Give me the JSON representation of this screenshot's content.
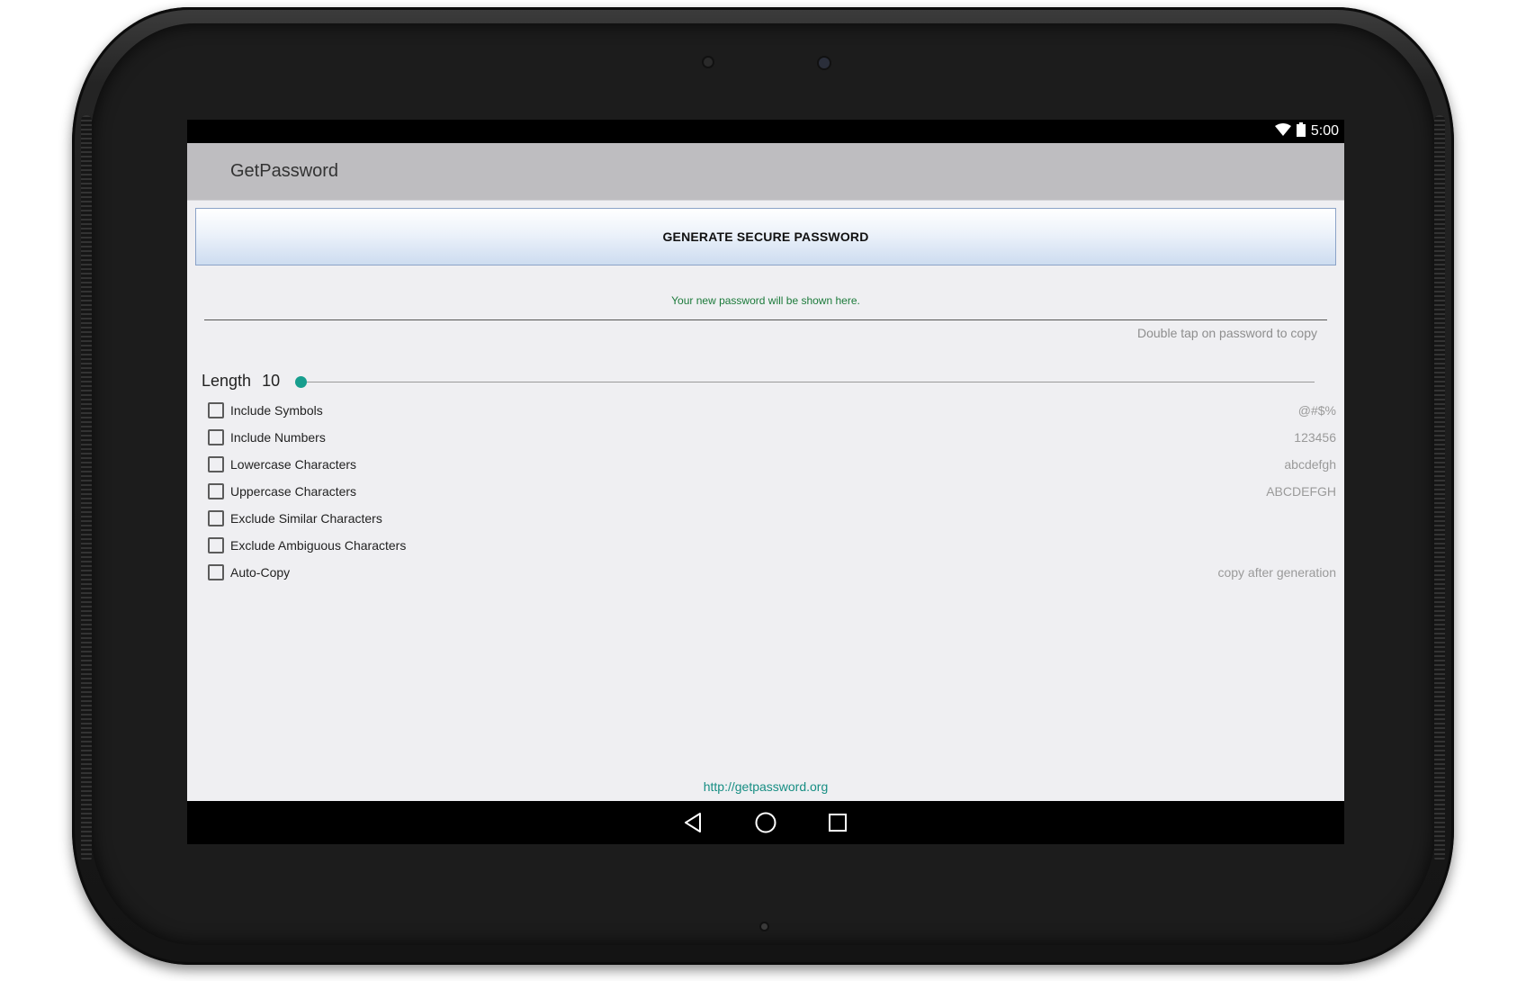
{
  "status_bar": {
    "time": "5:00",
    "icons": [
      "wifi-icon",
      "battery-icon"
    ]
  },
  "app": {
    "title": "GetPassword",
    "generate_button_label": "GENERATE SECURE PASSWORD",
    "password_placeholder": "Your new password will be shown here.",
    "copy_hint": "Double tap on password to copy",
    "length": {
      "label": "Length",
      "value": "10"
    },
    "options": [
      {
        "label": "Include Symbols",
        "sample": "@#$%",
        "checked": false
      },
      {
        "label": "Include Numbers",
        "sample": "123456",
        "checked": false
      },
      {
        "label": "Lowercase Characters",
        "sample": "abcdefgh",
        "checked": false
      },
      {
        "label": "Uppercase Characters",
        "sample": "ABCDEFGH",
        "checked": false
      },
      {
        "label": "Exclude Similar Characters",
        "sample": "",
        "checked": false
      },
      {
        "label": "Exclude Ambiguous Characters",
        "sample": "",
        "checked": false
      },
      {
        "label": "Auto-Copy",
        "sample": "copy after generation",
        "checked": false
      }
    ],
    "footer_link": "http://getpassword.org"
  },
  "nav_bar": {
    "buttons": [
      "back-icon",
      "home-icon",
      "recents-icon"
    ]
  },
  "colors": {
    "accent": "#179e8e",
    "password_text": "#1b7a3a",
    "action_bar": "#bebdc0",
    "background": "#efeff2"
  }
}
